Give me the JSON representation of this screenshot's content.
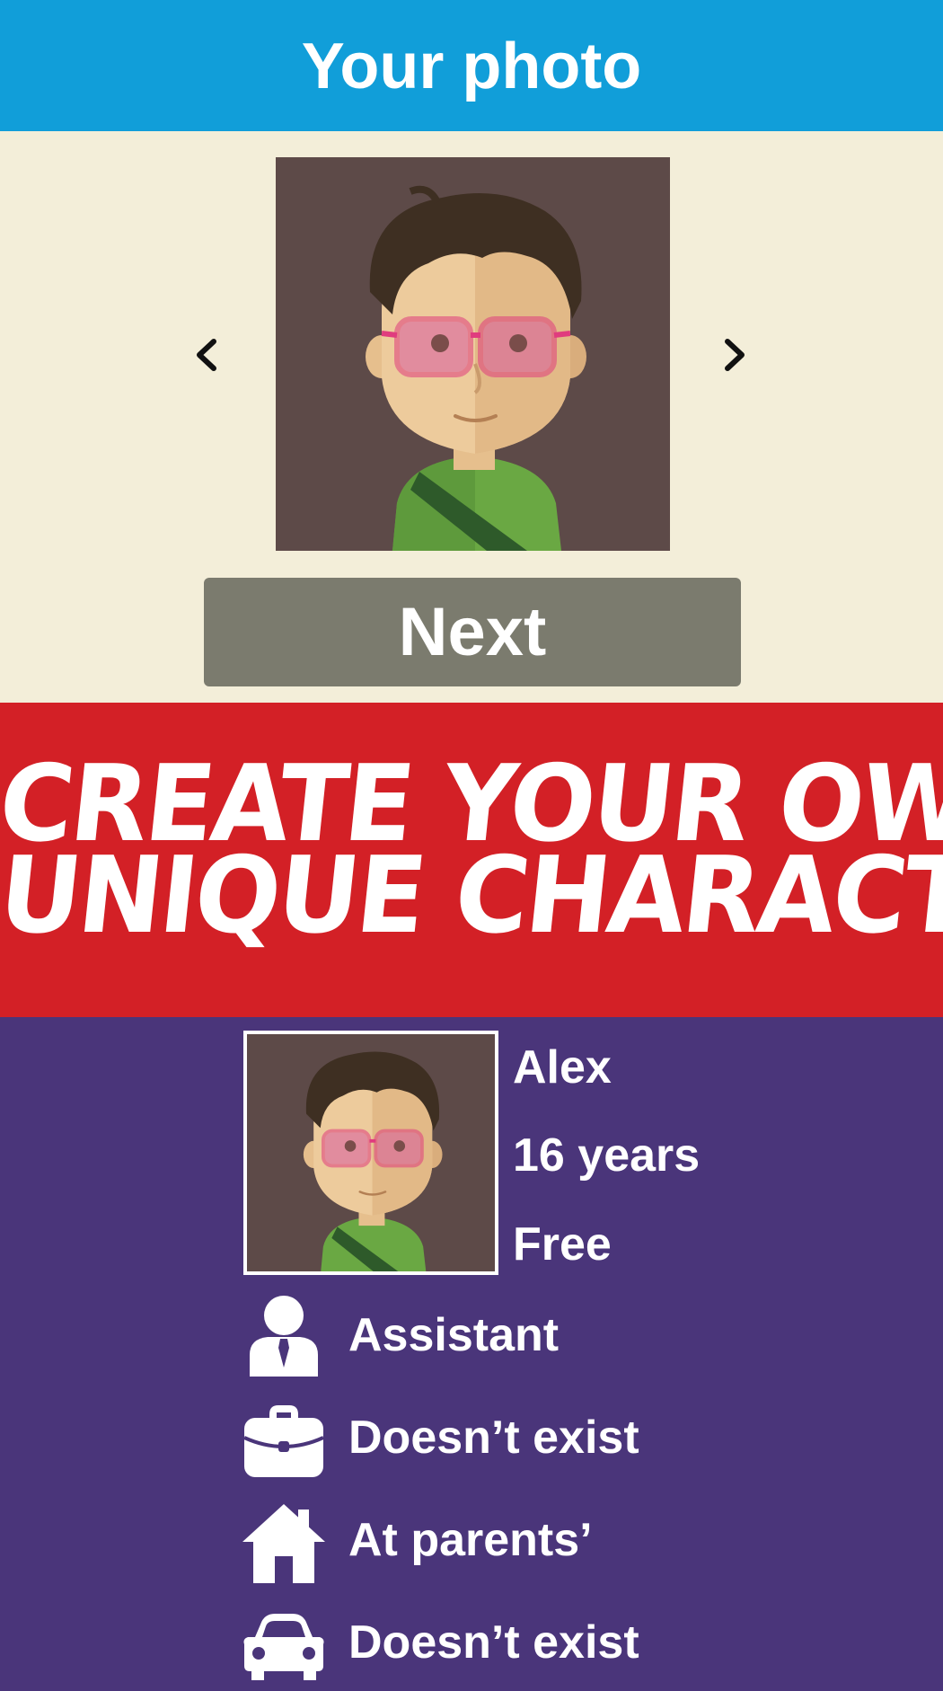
{
  "header": {
    "title": "Your photo"
  },
  "photo_picker": {
    "prev_icon": "chevron-left-icon",
    "next_icon": "chevron-right-icon",
    "next_button_label": "Next"
  },
  "banner": {
    "line1": "CREATE YOUR OWN",
    "line2": "UNIQUE CHARACTER!"
  },
  "profile": {
    "name": "Alex",
    "age": "16 years",
    "status": "Free",
    "rows": [
      {
        "icon": "person-tie-icon",
        "label": "Assistant"
      },
      {
        "icon": "briefcase-icon",
        "label": "Doesn’t exist"
      },
      {
        "icon": "house-icon",
        "label": "At parents’"
      },
      {
        "icon": "car-icon",
        "label": "Doesn’t exist"
      }
    ]
  },
  "colors": {
    "header_bg": "#119ed9",
    "photo_bg": "#f3eed9",
    "button_bg": "#7b7b6e",
    "banner_bg": "#d32026",
    "profile_bg": "#4a357a"
  }
}
